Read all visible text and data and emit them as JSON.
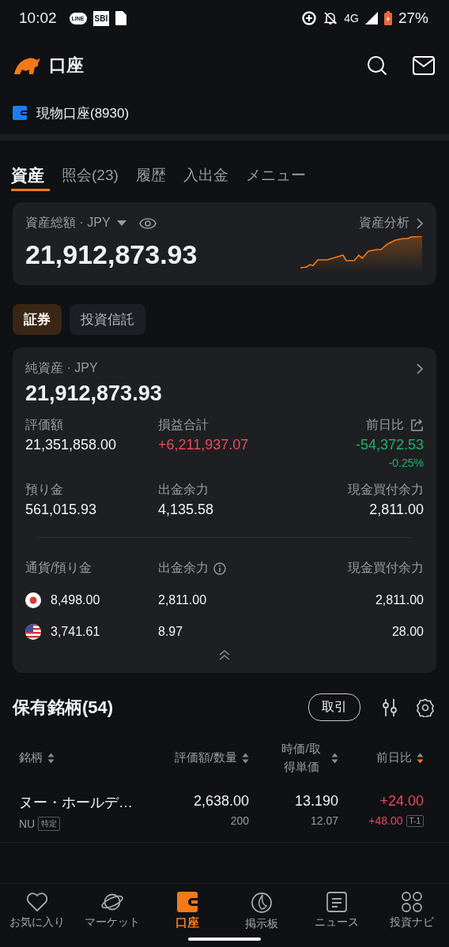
{
  "status_bar": {
    "time": "10:02",
    "app_icons": [
      "LINE",
      "SBI"
    ],
    "network": "4G",
    "battery": "27%"
  },
  "header": {
    "title": "口座"
  },
  "account": {
    "label": "現物口座(8930)"
  },
  "tabs": [
    {
      "label": "資産",
      "selected": true
    },
    {
      "label": "照会(23)",
      "selected": false
    },
    {
      "label": "履歴",
      "selected": false
    },
    {
      "label": "入出金",
      "selected": false
    },
    {
      "label": "メニュー",
      "selected": false
    }
  ],
  "total_card": {
    "label": "資産総額 · JPY",
    "link": "資産分析",
    "value": "21,912,873.93"
  },
  "segments": [
    {
      "label": "証券",
      "selected": true
    },
    {
      "label": "投資信託",
      "selected": false
    }
  ],
  "net_card": {
    "label": "純資産 · JPY",
    "value": "21,912,873.93",
    "metrics": [
      {
        "label": "評価額",
        "value": "21,351,858.00",
        "kind": "plain"
      },
      {
        "label": "損益合計",
        "value": "+6,211,937.07",
        "kind": "gain"
      },
      {
        "label": "前日比",
        "value": "-54,372.53",
        "sub": "-0.25%",
        "kind": "loss",
        "share": true
      },
      {
        "label": "預り金",
        "value": "561,015.93",
        "kind": "plain"
      },
      {
        "label": "出金余力",
        "value": "4,135.58",
        "kind": "plain"
      },
      {
        "label": "現金買付余力",
        "value": "2,811.00",
        "kind": "plain"
      }
    ],
    "currency_columns": [
      "通貨/預り金",
      "出金余力",
      "現金買付余力"
    ],
    "currencies": [
      {
        "kind": "jp",
        "deposit": "8,498.00",
        "withdrawable": "2,811.00",
        "buying_power": "2,811.00"
      },
      {
        "kind": "us",
        "deposit": "3,741.61",
        "withdrawable": "8.97",
        "buying_power": "28.00"
      }
    ]
  },
  "holdings": {
    "title": "保有銘柄(54)",
    "trade_button": "取引",
    "columns": [
      {
        "label": "銘柄",
        "sorted": false
      },
      {
        "label": "評価額/数量",
        "sorted": false
      },
      {
        "label": "時価/取得単価",
        "sorted": false
      },
      {
        "label": "前日比",
        "sorted": true
      }
    ],
    "rows": [
      {
        "name": "ヌー・ホールデ…",
        "ticker": "NU",
        "tag": "特定",
        "value": "2,638.00",
        "quantity": "200",
        "price": "13.190",
        "cost": "12.07",
        "change": "+24.00",
        "change_total": "+48.00",
        "badge": "T-1"
      }
    ]
  },
  "bottom_nav": [
    {
      "label": "お気に入り",
      "selected": false
    },
    {
      "label": "マーケット",
      "selected": false
    },
    {
      "label": "口座",
      "selected": true
    },
    {
      "label": "掲示板",
      "selected": false
    },
    {
      "label": "ニュース",
      "selected": false
    },
    {
      "label": "投資ナビ",
      "selected": false
    }
  ]
}
